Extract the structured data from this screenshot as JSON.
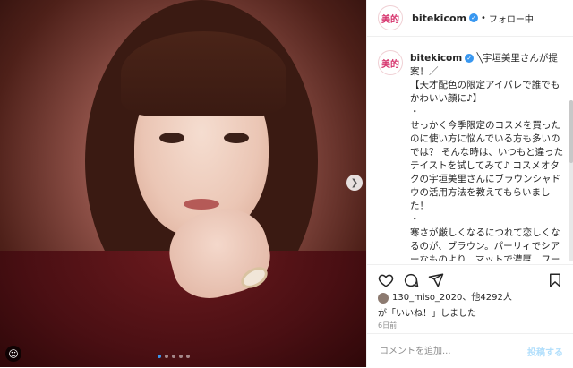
{
  "account": {
    "avatar_text": "美的",
    "username": "bitekicom",
    "following_label": "フォロー中",
    "separator": "•"
  },
  "caption": {
    "username": "bitekicom",
    "text": "╲宇垣美里さんが提案！／\n【天才配色の限定アイパレで誰でもかわいい顔に♪】\n・\nせっかく今季限定のコスメを買ったのに使い方に悩んでいる方も多いのでは？ そんな時は、いつもと違ったテイストを試してみて♪ コスメオタクの宇垣美里さんにブラウンシャドウの活用方法を教えてもらいました！\n・\n寒さが厳しくなるにつれて恋しくなるのが、ブラウン。パーリィでシアーなものより、マットで濃厚。フーフーしながら飲む熱々のカフェラテみたいに、こっくり感のある色味ならなお良し。アンプリチュードの限定パレットは“モカ”と“キャラメル”のニュアンスを感じる天才配色。これはかわいくならないはずがな"
  },
  "icons": {
    "like": "heart-icon",
    "comment": "comment-icon",
    "share": "share-icon",
    "save": "bookmark-icon",
    "next": "chevron-right-icon",
    "accessibility": "accessibility-icon"
  },
  "likes": {
    "line1": "130_miso_2020、他4292人",
    "line2": "が「いいね！」しました"
  },
  "timestamp": "6日前",
  "comment_box": {
    "placeholder": "コメントを追加...",
    "post_label": "投稿する"
  },
  "carousel": {
    "slide_count": 5,
    "active_index": 0
  },
  "colors": {
    "accent": "#3897f0",
    "brand": "#d6336c",
    "post_disabled": "#b2dffc"
  }
}
